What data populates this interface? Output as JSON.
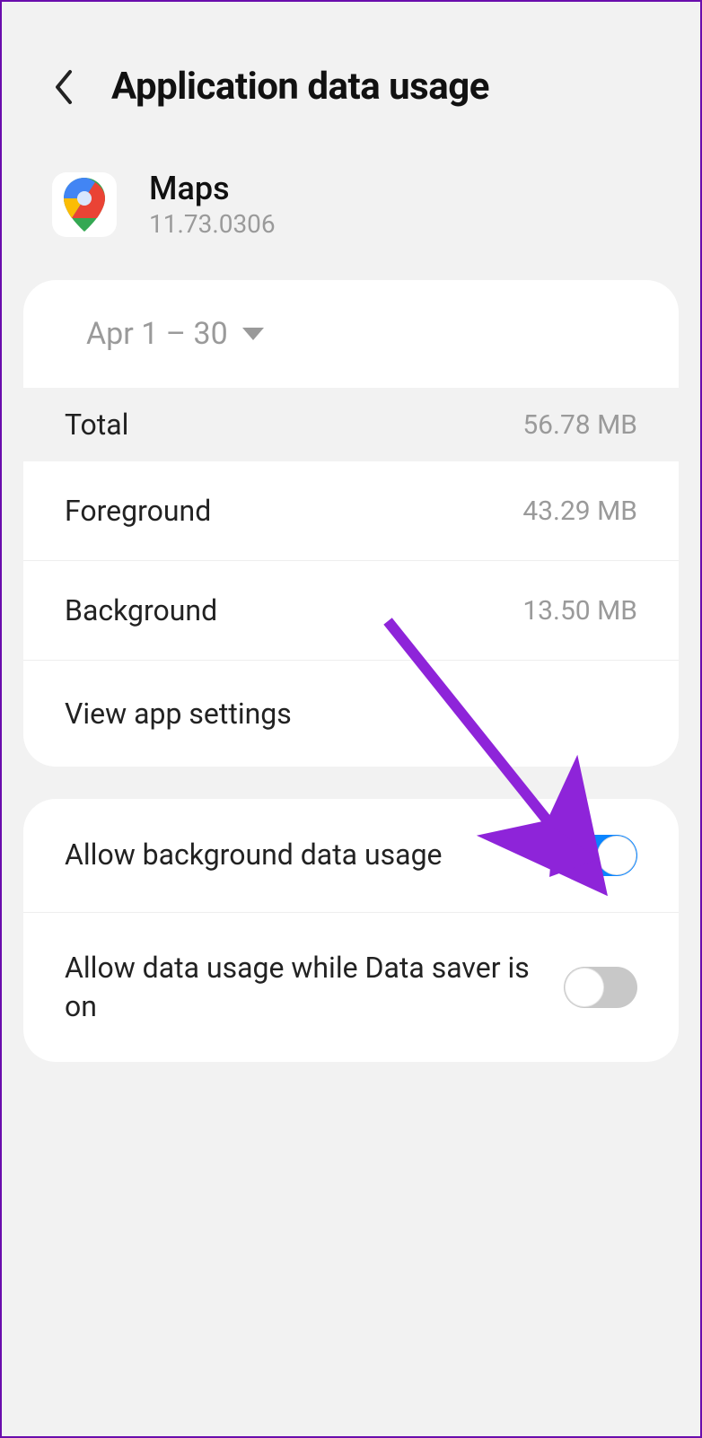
{
  "header": {
    "title": "Application data usage"
  },
  "app": {
    "name": "Maps",
    "version": "11.73.0306"
  },
  "date_range": "Apr 1 – 30",
  "stats": {
    "total_label": "Total",
    "total_value": "56.78 MB",
    "foreground_label": "Foreground",
    "foreground_value": "43.29 MB",
    "background_label": "Background",
    "background_value": "13.50 MB"
  },
  "view_settings_label": "View app settings",
  "toggles": {
    "bg_data_label": "Allow background data usage",
    "bg_data_on": true,
    "data_saver_label": "Allow data usage while Data saver is on",
    "data_saver_on": false
  }
}
